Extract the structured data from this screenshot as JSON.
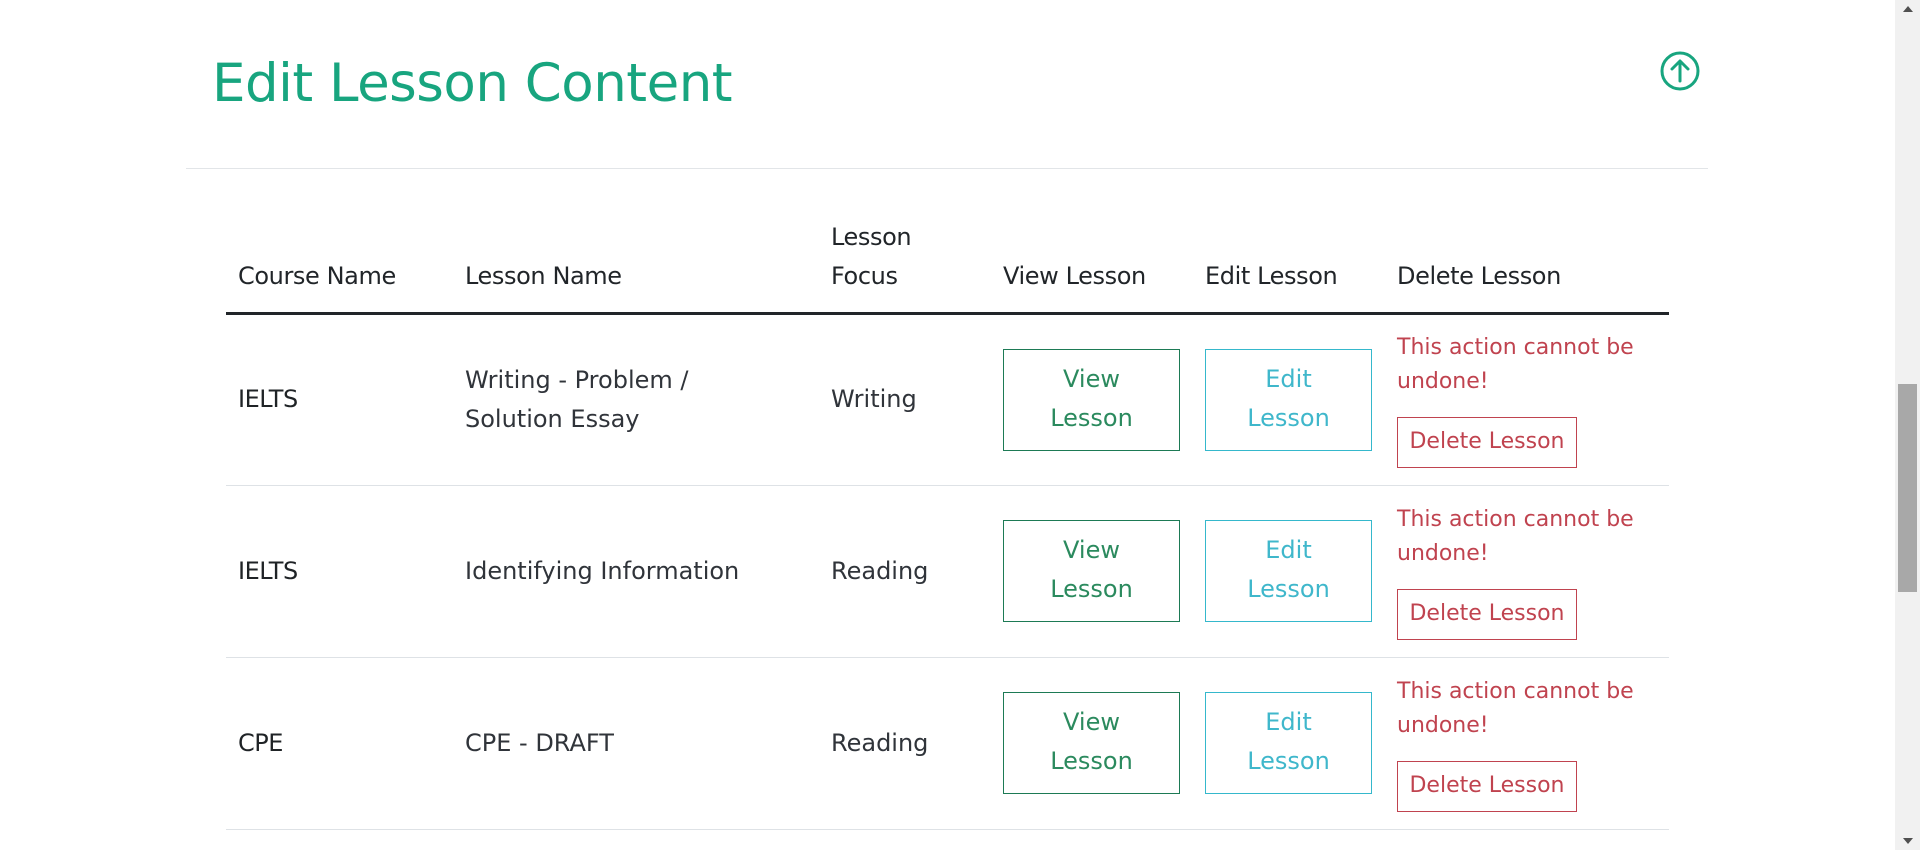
{
  "page": {
    "title": "Edit Lesson Content"
  },
  "table": {
    "headers": {
      "course_name": "Course Name",
      "lesson_name": "Lesson Name",
      "lesson_focus": "Lesson Focus",
      "view_lesson": "View Lesson",
      "edit_lesson": "Edit Lesson",
      "delete_lesson": "Delete Lesson"
    },
    "rows": [
      {
        "course": "IELTS",
        "lesson": "Writing - Problem / Solution Essay",
        "focus": "Writing",
        "view_label": "View Lesson",
        "edit_label": "Edit Lesson",
        "warning": "This action cannot be undone!",
        "delete_label": "Delete Lesson"
      },
      {
        "course": "IELTS",
        "lesson": "Identifying Information",
        "focus": "Reading",
        "view_label": "View Lesson",
        "edit_label": "Edit Lesson",
        "warning": "This action cannot be undone!",
        "delete_label": "Delete Lesson"
      },
      {
        "course": "CPE",
        "lesson": "CPE - DRAFT",
        "focus": "Reading",
        "view_label": "View Lesson",
        "edit_label": "Edit Lesson",
        "warning": "This action cannot be undone!",
        "delete_label": "Delete Lesson"
      }
    ]
  },
  "icons": {
    "scroll_top": "arrow-up-circle-icon",
    "scrollbar_up": "triangle-up-icon",
    "scrollbar_down": "triangle-down-icon"
  },
  "colors": {
    "title": "#18a57f",
    "view_button": "#2b8a5e",
    "edit_button": "#3fb7cb",
    "delete": "#c0434f"
  }
}
